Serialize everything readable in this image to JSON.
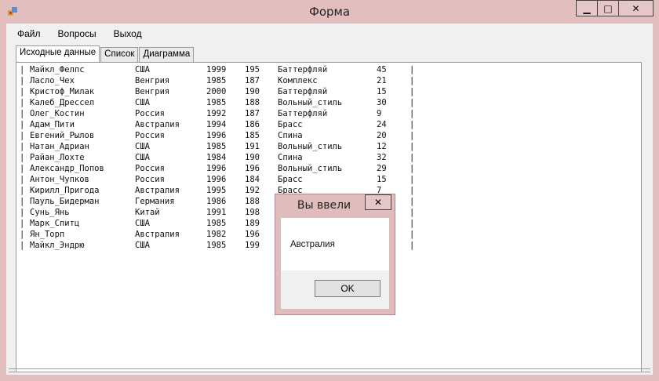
{
  "window": {
    "title": "Форма",
    "minimize_glyph": "▁",
    "maximize_glyph": "□",
    "close_glyph": "✕",
    "icon": "app-form-icon"
  },
  "menu": [
    "Файл",
    "Вопросы",
    "Выход"
  ],
  "tabs": [
    "Исходные данные",
    "Список",
    "Диаграмма"
  ],
  "records": [
    [
      "Майкл_Фелпс",
      "США",
      "1999",
      "195",
      "Баттерфляй",
      "45"
    ],
    [
      "Ласло_Чех",
      "Венгрия",
      "1985",
      "187",
      "Комплекс",
      "21"
    ],
    [
      "Кристоф_Милак",
      "Венгрия",
      "2000",
      "190",
      "Баттерфляй",
      "15"
    ],
    [
      "Калеб_Дрессел",
      "США",
      "1985",
      "188",
      "Вольный_стиль",
      "30"
    ],
    [
      "Олег_Костин",
      "Россия",
      "1992",
      "187",
      "Баттерфляй",
      "9"
    ],
    [
      "Адам_Пити",
      "Австралия",
      "1994",
      "186",
      "Брасс",
      "24"
    ],
    [
      "Евгений_Рылов",
      "Россия",
      "1996",
      "185",
      "Спина",
      "20"
    ],
    [
      "Натан_Адриан",
      "США",
      "1985",
      "191",
      "Вольный_стиль",
      "12"
    ],
    [
      "Райан_Лохте",
      "США",
      "1984",
      "190",
      "Спина",
      "32"
    ],
    [
      "Александр_Попов",
      "Россия",
      "1996",
      "196",
      "Вольный_стиль",
      "29"
    ],
    [
      "Антон_Чупков",
      "Россия",
      "1996",
      "184",
      "Брасс",
      "15"
    ],
    [
      "Кирилл_Пригода",
      "Австралия",
      "1995",
      "192",
      "Брасс",
      "7"
    ],
    [
      "Пауль_Бидерман",
      "Германия",
      "1986",
      "188",
      "",
      ""
    ],
    [
      "Сунь_Янь",
      "Китай",
      "1991",
      "198",
      "",
      ""
    ],
    [
      "Марк_Спитц",
      "США",
      "1985",
      "189",
      "",
      ""
    ],
    [
      "Ян_Торп",
      "Австралия",
      "1982",
      "196",
      "",
      ""
    ],
    [
      "Майкл_Эндрю",
      "США",
      "1985",
      "199",
      "",
      ""
    ]
  ],
  "separator": "|",
  "dialog": {
    "title": "Вы ввели",
    "message": "Австралия",
    "ok_label": "OK",
    "close_glyph": "✕"
  }
}
